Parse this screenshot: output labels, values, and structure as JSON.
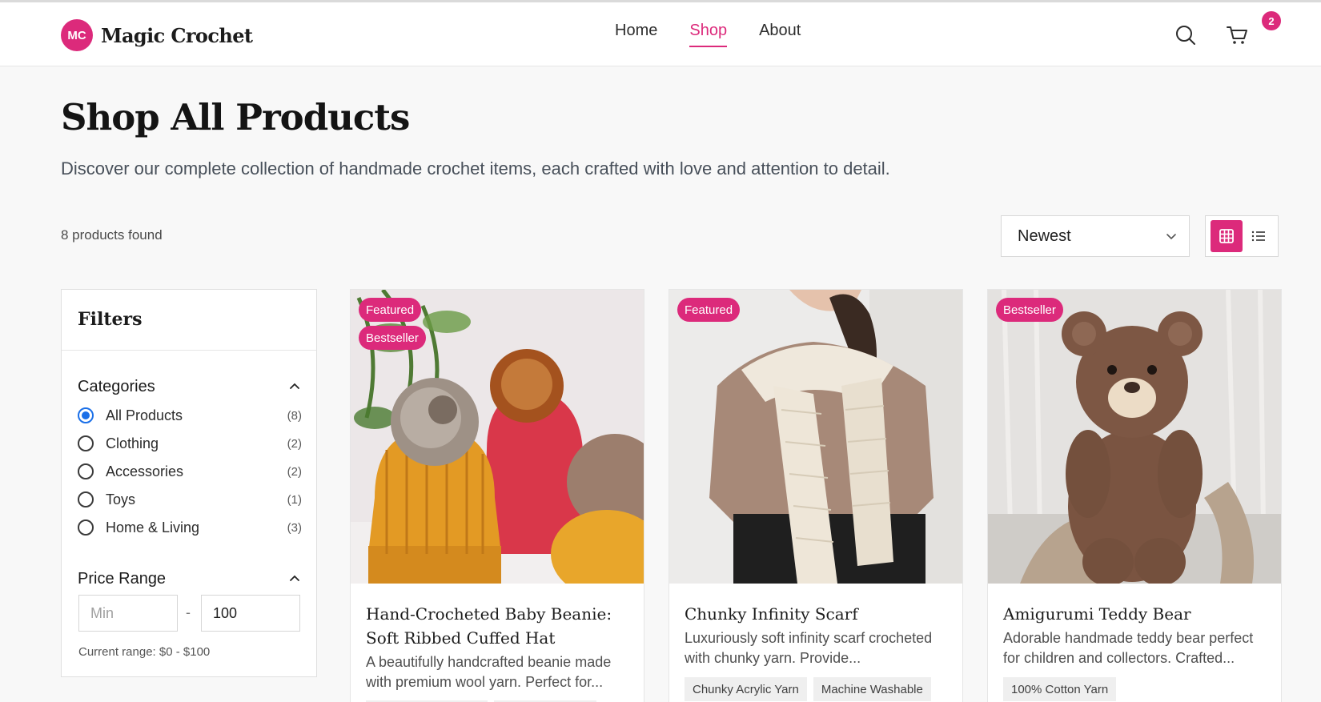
{
  "brand": {
    "badge": "MC",
    "name": "Magic Crochet",
    "accent": "#dc2a7b"
  },
  "nav": {
    "home": "Home",
    "shop": "Shop",
    "about": "About",
    "active": "Shop"
  },
  "header_icons": {
    "search": "search-icon",
    "cart": "cart-icon",
    "cart_count": "2"
  },
  "page": {
    "title": "Shop All Products",
    "subtitle": "Discover our complete collection of handmade crochet items, each crafted with love and attention to detail."
  },
  "toolbar": {
    "count": "8 products found",
    "sort_value": "Newest",
    "view_grid": "grid-icon",
    "view_list": "list-icon"
  },
  "filters": {
    "title": "Filters",
    "categories_heading": "Categories",
    "categories": [
      {
        "label": "All Products",
        "count": "(8)",
        "checked": true
      },
      {
        "label": "Clothing",
        "count": "(2)",
        "checked": false
      },
      {
        "label": "Accessories",
        "count": "(2)",
        "checked": false
      },
      {
        "label": "Toys",
        "count": "(1)",
        "checked": false
      },
      {
        "label": "Home & Living",
        "count": "(3)",
        "checked": false
      }
    ],
    "price_heading": "Price Range",
    "min_placeholder": "Min",
    "max_value": "100",
    "range_separator": "-",
    "current_range": "Current range: $0 - $100"
  },
  "products": [
    {
      "badges": [
        "Featured",
        "Bestseller"
      ],
      "title": "Hand-Crocheted Baby Beanie: Soft Ribbed Cuffed Hat",
      "desc": "A beautifully handcrafted beanie made with premium wool yarn. Perfect for...",
      "tags": []
    },
    {
      "badges": [
        "Featured"
      ],
      "title": "Chunky Infinity Scarf",
      "desc": "Luxuriously soft infinity scarf crocheted with chunky yarn. Provide...",
      "tags": [
        "Chunky Acrylic Yarn",
        "Machine Washable"
      ]
    },
    {
      "badges": [
        "Bestseller"
      ],
      "title": "Amigurumi Teddy Bear",
      "desc": "Adorable handmade teddy bear perfect for children and collectors. Crafted...",
      "tags": [
        "100% Cotton Yarn"
      ]
    }
  ]
}
